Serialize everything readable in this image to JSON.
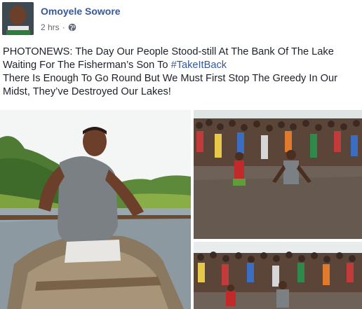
{
  "post": {
    "author": "Omoyele Sowore",
    "time": "2 hrs",
    "separator": "·",
    "privacy_icon": "globe-icon",
    "text_line_1": "PHOTONEWS: The Day Our People Stood-still At The Bank Of The Lake Waiting For The Fisherman’s Son To ",
    "hashtag": "#TakeItBack",
    "text_line_2": "There Is Enough To Go Round But We Must First Stop The Greedy In Our Midst, They’ve Destroyed Our Lakes!"
  },
  "photos": [
    {
      "name": "man-in-canoe-photo"
    },
    {
      "name": "crowd-and-men-in-water-photo"
    },
    {
      "name": "crowd-at-lake-bank-photo"
    }
  ],
  "colors": {
    "author": "#385898",
    "hashtag": "#365899",
    "text": "#1d2129",
    "meta": "#616770"
  }
}
